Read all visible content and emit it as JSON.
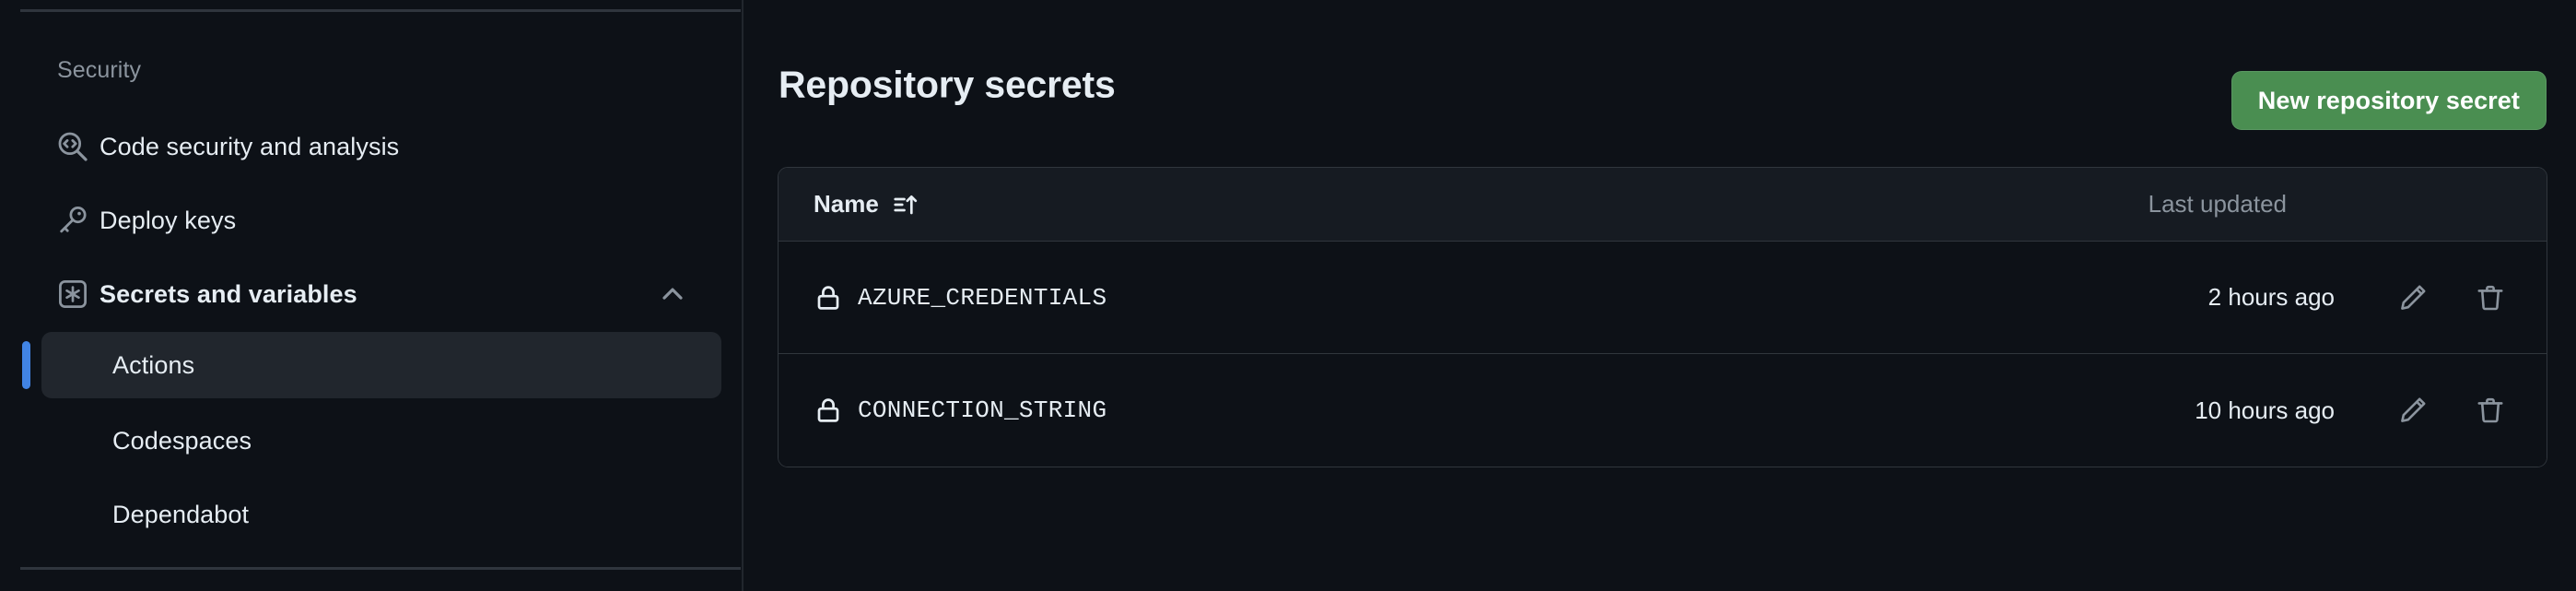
{
  "sidebar": {
    "heading": "Security",
    "items": [
      {
        "label": "Code security and analysis",
        "icon": "code-scan-icon"
      },
      {
        "label": "Deploy keys",
        "icon": "key-icon"
      },
      {
        "label": "Secrets and variables",
        "icon": "asterisk-square-icon",
        "chevron": "chevron-up-icon",
        "expanded": true
      }
    ],
    "sub_items": [
      {
        "label": "Actions",
        "active": true
      },
      {
        "label": "Codespaces",
        "active": false
      },
      {
        "label": "Dependabot",
        "active": false
      }
    ]
  },
  "main": {
    "title": "Repository secrets",
    "new_secret_button": "New repository secret",
    "table": {
      "columns": [
        "Name",
        "Last updated"
      ],
      "sort_icon": "sort-ascending-icon",
      "rows": [
        {
          "icon": "lock-icon",
          "name": "AZURE_CREDENTIALS",
          "last_updated": "2 hours ago",
          "edit_icon": "pencil-icon",
          "delete_icon": "trash-icon"
        },
        {
          "icon": "lock-icon",
          "name": "CONNECTION_STRING",
          "last_updated": "10 hours ago",
          "edit_icon": "pencil-icon",
          "delete_icon": "trash-icon"
        }
      ]
    }
  },
  "colors": {
    "page_background": "#0d1117",
    "surface": "#161b22",
    "border": "#30363d",
    "text_primary": "#e6edf3",
    "text_muted": "#8b949e",
    "accent_blue": "#4184e4",
    "button_green": "#4a8e51"
  }
}
